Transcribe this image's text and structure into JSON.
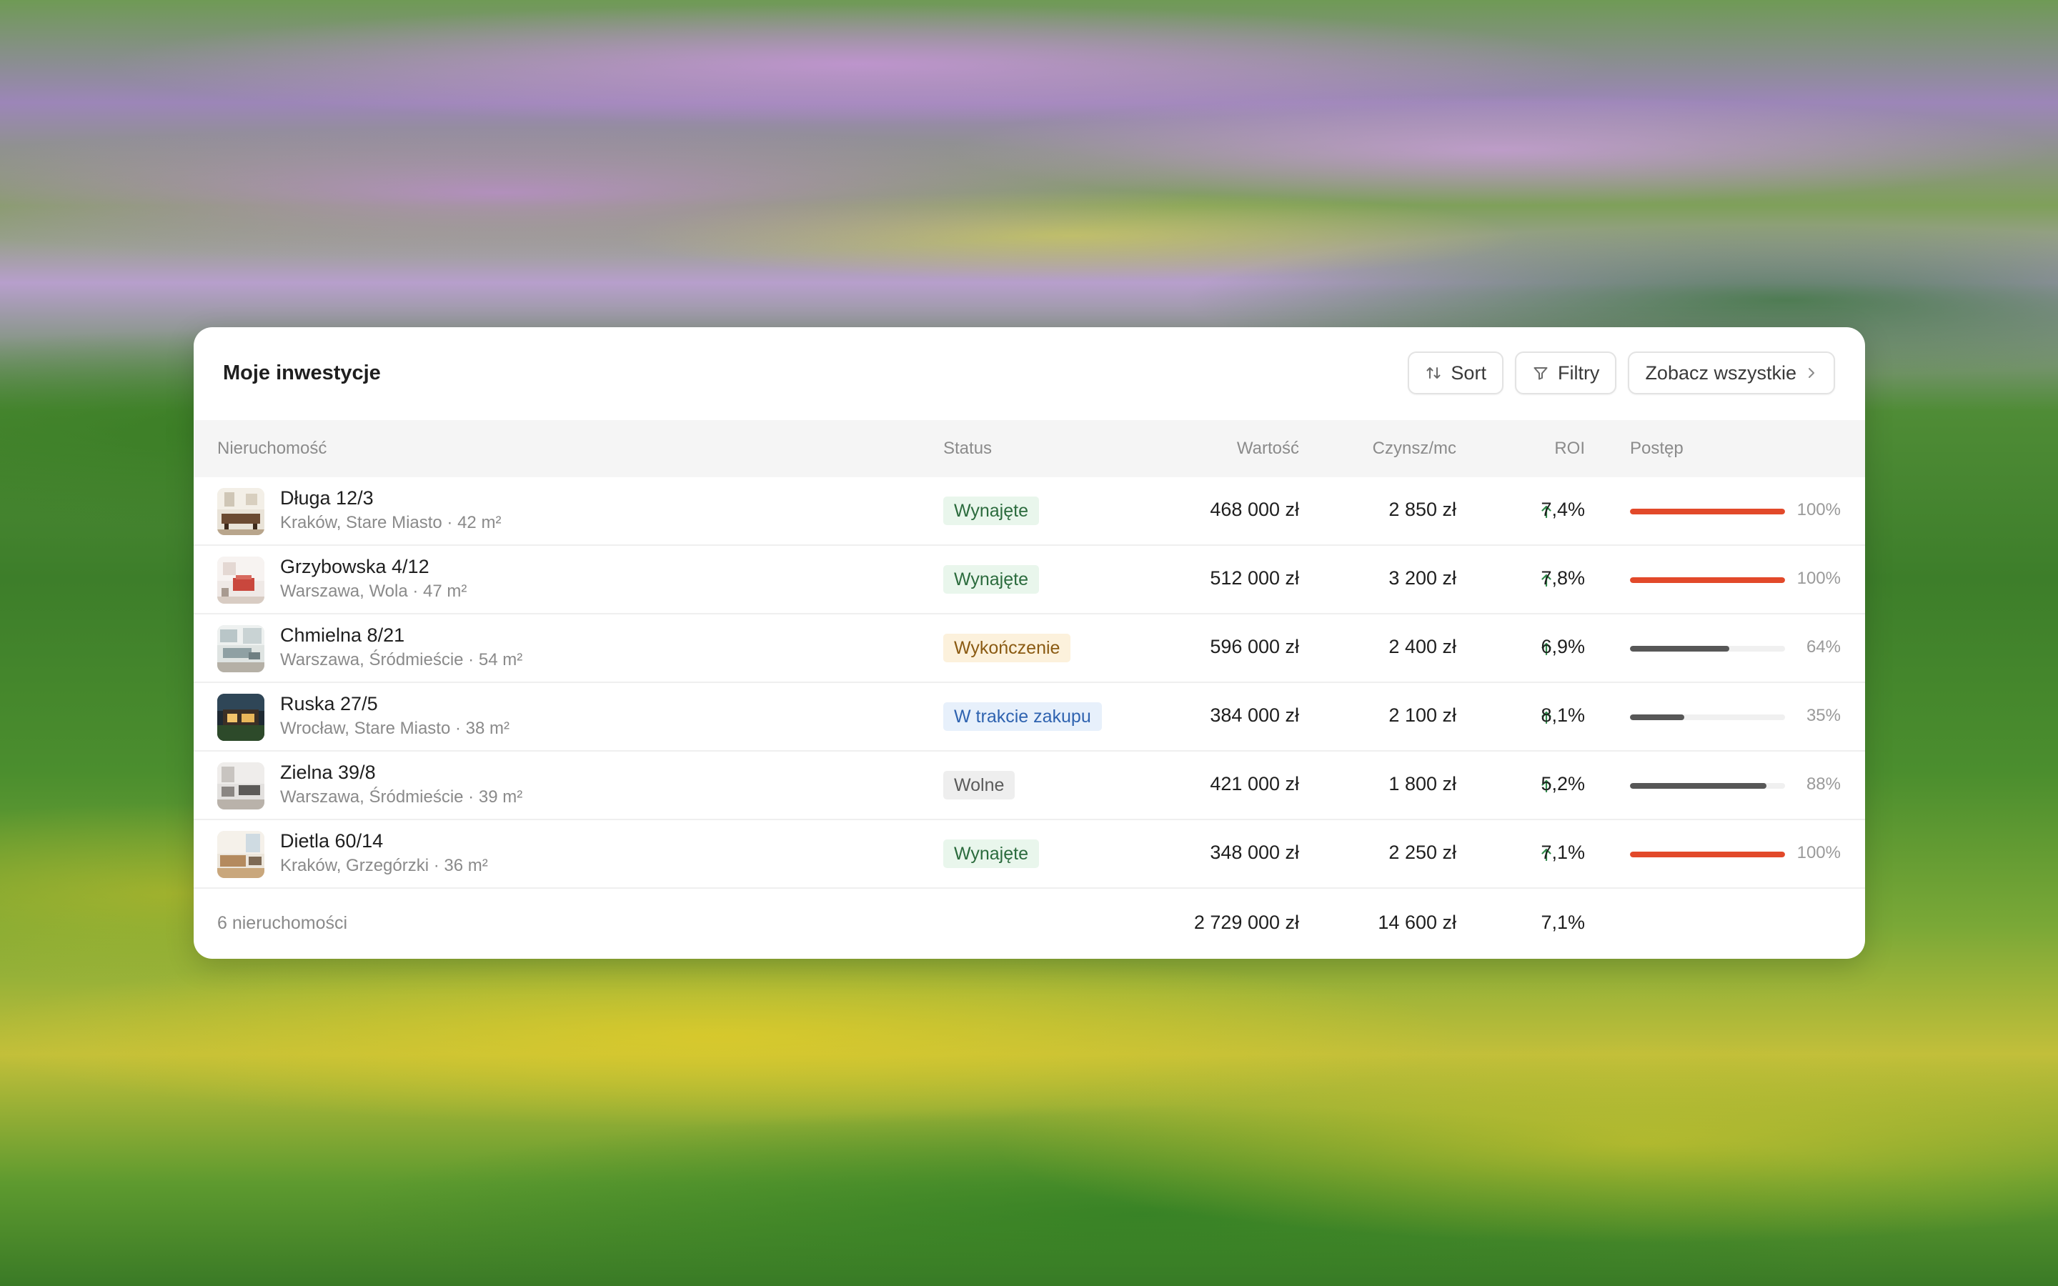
{
  "panel": {
    "title": "Moje inwestycje",
    "toolbar": {
      "sort_label": "Sort",
      "filter_label": "Filtry",
      "view_all_label": "Zobacz wszystkie"
    }
  },
  "table": {
    "columns": {
      "property": "Nieruchomość",
      "status": "Status",
      "value": "Wartość",
      "rent": "Czynsz/mc",
      "roi": "ROI",
      "progress": "Postęp"
    },
    "rows": [
      {
        "name": "Długa 12/3",
        "location": "Kraków, Stare Miasto · 42 m²",
        "status": "Wynajęte",
        "status_tone": "green",
        "value": "468 000 zł",
        "rent": "2 850 zł",
        "roi": "7,4%",
        "progress": 100,
        "progress_label": "100%"
      },
      {
        "name": "Grzybowska 4/12",
        "location": "Warszawa, Wola · 47 m²",
        "status": "Wynajęte",
        "status_tone": "green",
        "value": "512 000 zł",
        "rent": "3 200 zł",
        "roi": "7,8%",
        "progress": 100,
        "progress_label": "100%"
      },
      {
        "name": "Chmielna 8/21",
        "location": "Warszawa, Śródmieście · 54 m²",
        "status": "Wykończenie",
        "status_tone": "amber",
        "value": "596 000 zł",
        "rent": "2 400 zł",
        "roi": "6,9%",
        "progress": 64,
        "progress_label": "64%"
      },
      {
        "name": "Ruska 27/5",
        "location": "Wrocław, Stare Miasto · 38 m²",
        "status": "W trakcie zakupu",
        "status_tone": "blue",
        "value": "384 000 zł",
        "rent": "2 100 zł",
        "roi": "8,1%",
        "progress": 35,
        "progress_label": "35%"
      },
      {
        "name": "Zielna 39/8",
        "location": "Warszawa, Śródmieście · 39 m²",
        "status": "Wolne",
        "status_tone": "gray",
        "value": "421 000 zł",
        "rent": "1 800 zł",
        "roi": "5,2%",
        "progress": 88,
        "progress_label": "88%"
      },
      {
        "name": "Dietla 60/14",
        "location": "Kraków, Grzegórzki · 36 m²",
        "status": "Wynajęte",
        "status_tone": "green",
        "value": "348 000 zł",
        "rent": "2 250 zł",
        "roi": "7,1%",
        "progress": 100,
        "progress_label": "100%"
      }
    ],
    "footer": {
      "count_label": "6 nieruchomości",
      "total_value": "2 729 000 zł",
      "total_rent": "14 600 zł",
      "avg_roi": "7,1%"
    }
  },
  "colors": {
    "progress_complete": "#e2492a",
    "progress_partial": "#575757",
    "roi_positive": "#2f8a4a"
  },
  "icons": {
    "sort": "sort-arrows-icon",
    "filter": "filter-funnel-icon",
    "view_all": "chevron-right-icon",
    "roi_up": "arrow-up-icon"
  }
}
